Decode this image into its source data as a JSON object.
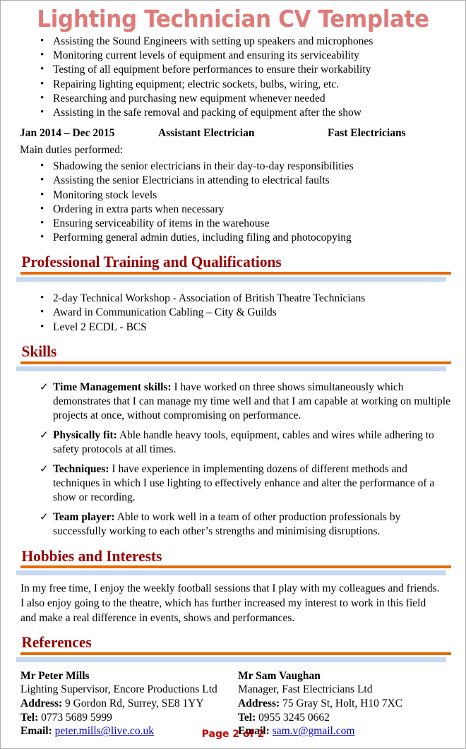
{
  "document": {
    "title": "Lighting Technician CV Template",
    "footer": "Page 2 of 2",
    "colors": {
      "title": "#DE7B79",
      "heading": "#990000",
      "rule_orange": "#E36C09",
      "rule_blue": "#C6D9F1",
      "link": "#0000CC",
      "footer": "#C00000"
    }
  },
  "top_duties": [
    "Assisting the Sound Engineers with setting up speakers and microphones",
    "Monitoring current levels of equipment and ensuring its serviceability",
    "Testing of all equipment before performances to ensure their workability",
    "Repairing lighting equipment; electric sockets, bulbs, wiring, etc.",
    "Researching and purchasing new equipment whenever needed",
    "Assisting in the safe removal and packing of equipment after the show"
  ],
  "experience": {
    "dates": "Jan 2014 – Dec 2015",
    "job_title": "Assistant Electrician",
    "company": "Fast Electricians",
    "duties_label": "Main duties performed:",
    "duties": [
      "Shadowing the senior electricians in their day-to-day responsibilities",
      "Assisting the senior Electricians in attending to electrical faults",
      "Monitoring stock levels",
      "Ordering in extra parts when necessary",
      "Ensuring serviceability of items in the warehouse",
      "Performing general admin duties, including filing and photocopying"
    ]
  },
  "training": {
    "heading": "Professional Training and Qualifications",
    "items": [
      "2-day Technical Workshop - Association of British Theatre Technicians",
      "Award in Communication Cabling – City & Guilds",
      "Level 2 ECDL - BCS"
    ]
  },
  "skills": {
    "heading": "Skills",
    "items": [
      {
        "lead": "Time Management skills:",
        "text": " I have worked on three shows simultaneously which demonstrates that I can manage my time well and that I am capable at working on multiple projects at once, without compromising on performance."
      },
      {
        "lead": "Physically fit:",
        "text": " Able handle heavy tools, equipment, cables and wires while adhering to safety protocols at all times."
      },
      {
        "lead": "Techniques:",
        "text": " I have experience in implementing dozens of different methods and techniques in which I use lighting to effectively enhance and alter the performance of a show or recording."
      },
      {
        "lead": "Team player:",
        "text": " Able to work well in a team of other production professionals by successfully working to each other’s strengths and minimising disruptions."
      }
    ]
  },
  "hobbies": {
    "heading": "Hobbies and Interests",
    "text": "In my free time, I enjoy the weekly football sessions that I play with my colleagues and friends. I also enjoy going to the theatre, which has further increased my interest to work in this field and make a real difference in events, shows and performances."
  },
  "references": {
    "heading": "References",
    "labels": {
      "address": "Address:",
      "tel": "Tel:",
      "email": "Email:"
    },
    "entries": [
      {
        "name": "Mr Peter Mills",
        "role": "Lighting Supervisor, Encore Productions Ltd",
        "address": "9 Gordon Rd, Surrey, SE8 1YY",
        "tel": "0773 5689 5999",
        "email": "peter.mills@live.co.uk"
      },
      {
        "name": "Mr Sam Vaughan",
        "role": "Manager, Fast Electricians Ltd",
        "address": "75 Gray St, Holt, H10 7XC",
        "tel": "0955 3245 0662",
        "email": "sam.v@gmail.com"
      }
    ]
  }
}
